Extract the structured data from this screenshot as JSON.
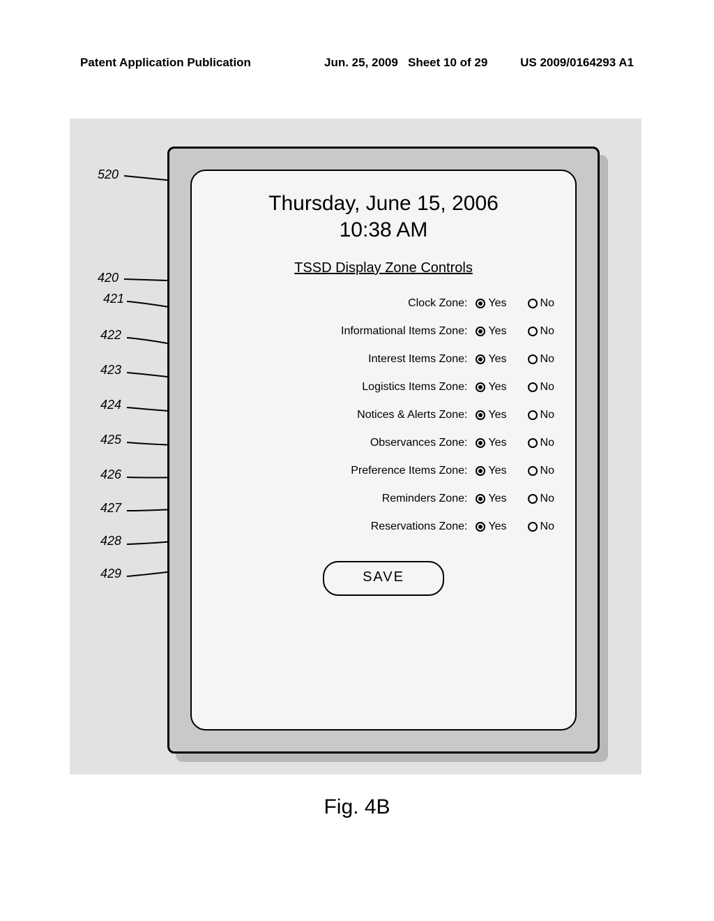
{
  "header": {
    "publication": "Patent Application Publication",
    "date": "Jun. 25, 2009",
    "sheet": "Sheet 10 of 29",
    "patno": "US 2009/0164293 A1"
  },
  "refs": {
    "r520": "520",
    "r420": "420",
    "r421": "421",
    "r422": "422",
    "r423": "423",
    "r424": "424",
    "r425": "425",
    "r426": "426",
    "r427": "427",
    "r428": "428",
    "r429": "429"
  },
  "screen": {
    "date": "Thursday, June 15, 2006",
    "time": "10:38 AM",
    "section_title": "TSSD Display Zone Controls",
    "yes": "Yes",
    "no": "No",
    "save": "SAVE",
    "zones": [
      {
        "label": "Clock Zone:",
        "value": "yes"
      },
      {
        "label": "Informational Items Zone:",
        "value": "yes"
      },
      {
        "label": "Interest Items Zone:",
        "value": "yes"
      },
      {
        "label": "Logistics Items Zone:",
        "value": "yes"
      },
      {
        "label": "Notices & Alerts Zone:",
        "value": "yes"
      },
      {
        "label": "Observances Zone:",
        "value": "yes"
      },
      {
        "label": "Preference Items Zone:",
        "value": "yes"
      },
      {
        "label": "Reminders Zone:",
        "value": "yes"
      },
      {
        "label": "Reservations Zone:",
        "value": "yes"
      }
    ]
  },
  "caption": "Fig. 4B"
}
